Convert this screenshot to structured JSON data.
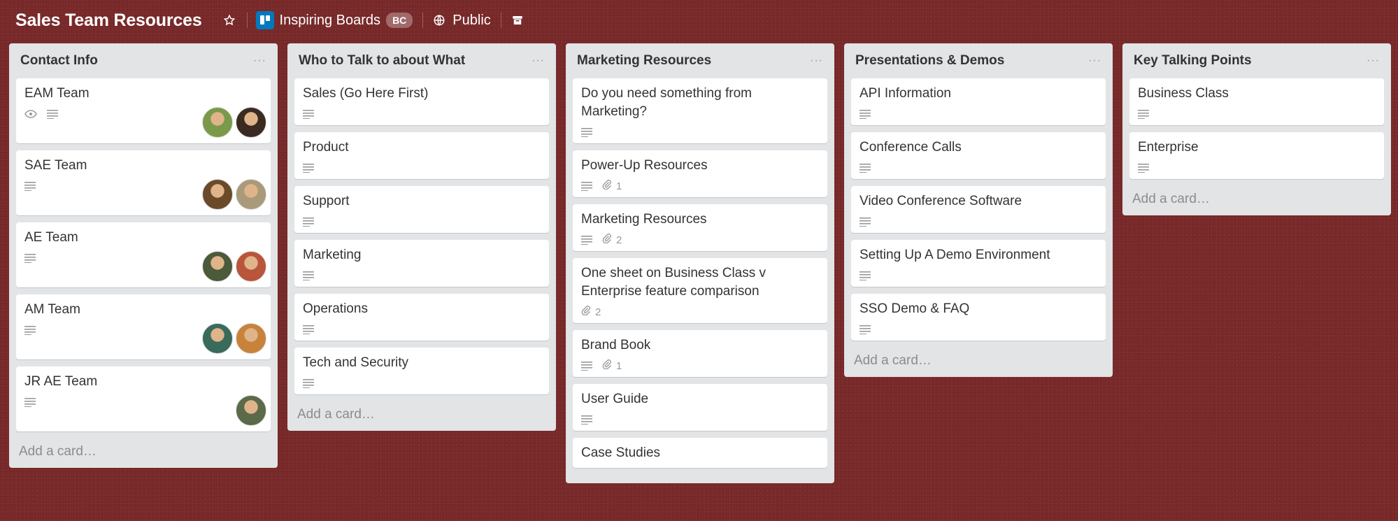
{
  "header": {
    "board_title": "Sales Team Resources",
    "team_name": "Inspiring Boards",
    "team_badge": "BC",
    "visibility": "Public",
    "star_icon": "star-icon",
    "archive_icon": "archive-icon"
  },
  "colors": {
    "board_bg": "#7a2a2a",
    "list_bg": "#e2e4e6",
    "team_logo": "#0079bf"
  },
  "add_card_label": "Add a card…",
  "lists": [
    {
      "title": "Contact Info",
      "cards": [
        {
          "title": "EAM Team",
          "watch": true,
          "desc": true,
          "members": [
            "#7a9a4a",
            "#3a2a22"
          ]
        },
        {
          "title": "SAE Team",
          "desc": true,
          "members": [
            "#6b4a2a",
            "#a89a7a"
          ]
        },
        {
          "title": "AE Team",
          "desc": true,
          "members": [
            "#4a5a3a",
            "#b8553a"
          ]
        },
        {
          "title": "AM Team",
          "desc": true,
          "members": [
            "#3a6a5a",
            "#c8823a"
          ]
        },
        {
          "title": "JR AE Team",
          "desc": true,
          "members": [
            "#5a6a4a"
          ]
        }
      ]
    },
    {
      "title": "Who to Talk to about What",
      "cards": [
        {
          "title": "Sales (Go Here First)",
          "desc": true
        },
        {
          "title": "Product",
          "desc": true
        },
        {
          "title": "Support",
          "desc": true
        },
        {
          "title": "Marketing",
          "desc": true
        },
        {
          "title": "Operations",
          "desc": true
        },
        {
          "title": "Tech and Security",
          "desc": true
        }
      ]
    },
    {
      "title": "Marketing Resources",
      "cards": [
        {
          "title": "Do you need something from Marketing?",
          "desc": true
        },
        {
          "title": "Power-Up Resources",
          "desc": true,
          "attachments": "1"
        },
        {
          "title": "Marketing Resources",
          "desc": true,
          "attachments": "2"
        },
        {
          "title": "One sheet on Business Class v Enterprise feature comparison",
          "attachments": "2"
        },
        {
          "title": "Brand Book",
          "desc": true,
          "attachments": "1"
        },
        {
          "title": "User Guide",
          "desc": true
        },
        {
          "title": "Case Studies"
        }
      ]
    },
    {
      "title": "Presentations & Demos",
      "cards": [
        {
          "title": "API Information",
          "desc": true
        },
        {
          "title": "Conference Calls",
          "desc": true
        },
        {
          "title": "Video Conference Software",
          "desc": true
        },
        {
          "title": "Setting Up A Demo Environment",
          "desc": true
        },
        {
          "title": "SSO Demo & FAQ",
          "desc": true
        }
      ]
    },
    {
      "title": "Key Talking Points",
      "cards": [
        {
          "title": "Business Class",
          "desc": true
        },
        {
          "title": "Enterprise",
          "desc": true
        }
      ]
    }
  ]
}
